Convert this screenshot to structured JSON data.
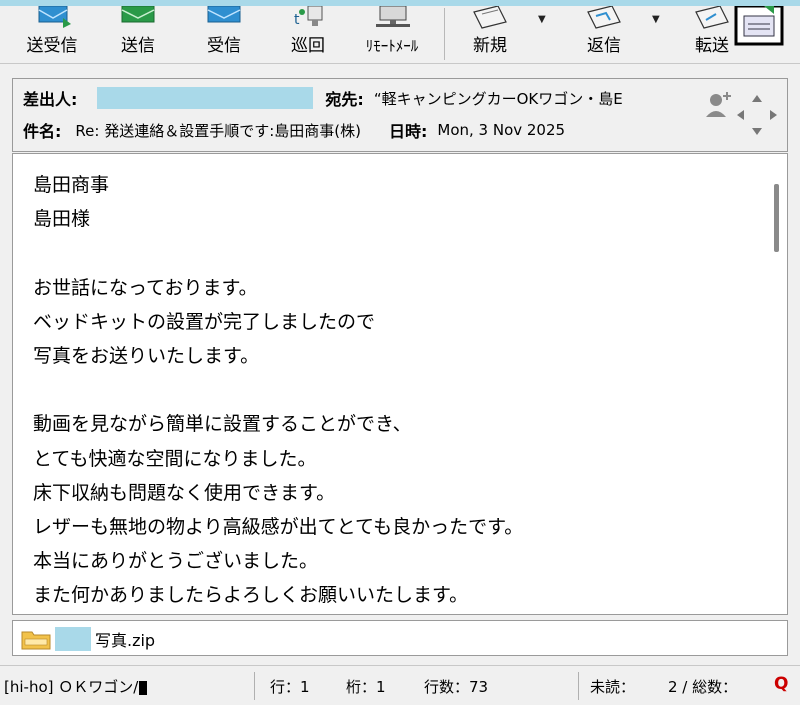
{
  "toolbar": {
    "buttons": [
      {
        "label": "送受信",
        "icon": "send-receive-icon"
      },
      {
        "label": "送信",
        "icon": "send-icon"
      },
      {
        "label": "受信",
        "icon": "receive-icon"
      },
      {
        "label": "巡回",
        "icon": "patrol-icon"
      },
      {
        "label": "ﾘﾓｰﾄﾒｰﾙ",
        "icon": "remote-mail-icon"
      },
      {
        "label": "新規",
        "icon": "new-mail-icon"
      },
      {
        "label": "返信",
        "icon": "reply-icon"
      },
      {
        "label": "転送",
        "icon": "forward-icon"
      }
    ]
  },
  "header": {
    "from_label": "差出人:",
    "to_label": "宛先:",
    "to_value": "“軽キャンピングカーOKワゴン・島E",
    "subject_label": "件名:",
    "subject_value": "Re: 発送連絡＆設置手順です:島田商事(株)",
    "date_label": "日時:",
    "date_value": "Mon, 3 Nov 2025"
  },
  "body": {
    "text": "島田商事\n島田様\n\nお世話になっております。\nベッドキットの設置が完了しましたので\n写真をお送りいたします。\n\n動画を見ながら簡単に設置することができ、\nとても快適な空間になりました。\n床下収納も問題なく使用できます。\nレザーも無地の物より高級感が出てとても良かったです。\n本当にありがとうございました。\nまた何かありましたらよろしくお願いいたします。"
  },
  "attachment": {
    "filename": "写真.zip"
  },
  "status": {
    "account": "[hi-ho] ＯＫワゴン/",
    "line": "行：1",
    "column": "桁：1",
    "line_count": "行数：73",
    "unread": "未読：",
    "total": "2 / 総数：",
    "q_glyph": "Q"
  },
  "colors": {
    "redaction": "#a9d9e9",
    "envelope_blue": "#2f8fd0",
    "envelope_green": "#2a9a48",
    "q_red": "#cc0000"
  }
}
